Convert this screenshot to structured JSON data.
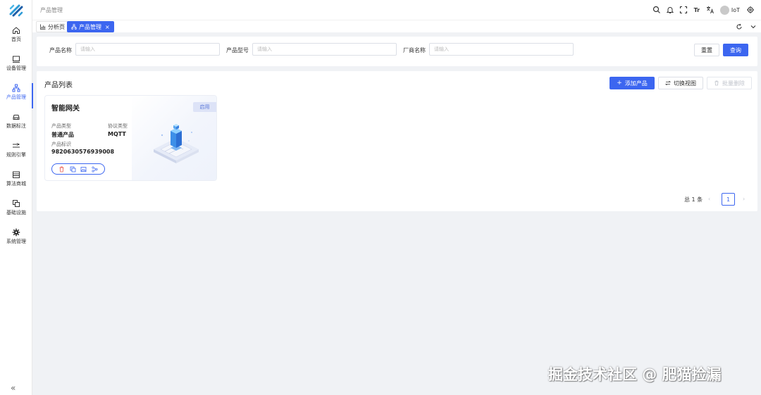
{
  "colors": {
    "accent": "#3c66f0",
    "badge_bg": "#dde3f7",
    "danger": "#e9564b"
  },
  "sidebar": {
    "logo_icon": "brand-logo-icon",
    "items": [
      {
        "label": "首页",
        "icon": "home-icon"
      },
      {
        "label": "设备管理",
        "icon": "monitor-icon"
      },
      {
        "label": "产品管理",
        "icon": "hierarchy-icon",
        "active": true
      },
      {
        "label": "数据标注",
        "icon": "car-icon"
      },
      {
        "label": "规则引擎",
        "icon": "flow-icon"
      },
      {
        "label": "算法商城",
        "icon": "store-icon"
      },
      {
        "label": "基础设施",
        "icon": "copy-icon"
      },
      {
        "label": "系统管理",
        "icon": "gear-icon"
      }
    ],
    "collapse_label": "«"
  },
  "header": {
    "breadcrumb": "产品管理",
    "user_name": "IoT",
    "font_size_icon_label": "Tr"
  },
  "tabs": [
    {
      "label": "分析页",
      "icon": "bar-chart-icon"
    },
    {
      "label": "产品管理",
      "icon": "hierarchy-icon",
      "active": true,
      "close": "×"
    }
  ],
  "search": {
    "fields": [
      {
        "label": "产品名称",
        "placeholder": "请输入"
      },
      {
        "label": "产品型号",
        "placeholder": "请输入"
      },
      {
        "label": "厂商名称",
        "placeholder": "请输入"
      }
    ],
    "reset_label": "重置",
    "query_label": "查询"
  },
  "product_list": {
    "title": "产品列表",
    "add_label": "添加产品",
    "switch_view_label": "切换视图",
    "batch_delete_label": "批量删除",
    "cards": [
      {
        "name": "智能网关",
        "status": "启用",
        "type_label": "产品类型",
        "type_value": "普通产品",
        "protocol_label": "协议类型",
        "protocol_value": "MQTT",
        "id_label": "产品标识",
        "id_value": "9820630576939008"
      }
    ]
  },
  "pagination": {
    "total": "总 1 条",
    "current_page": "1",
    "prev": "‹",
    "next": "›"
  },
  "watermark": "掘金技术社区 @ 肥猫捡漏"
}
